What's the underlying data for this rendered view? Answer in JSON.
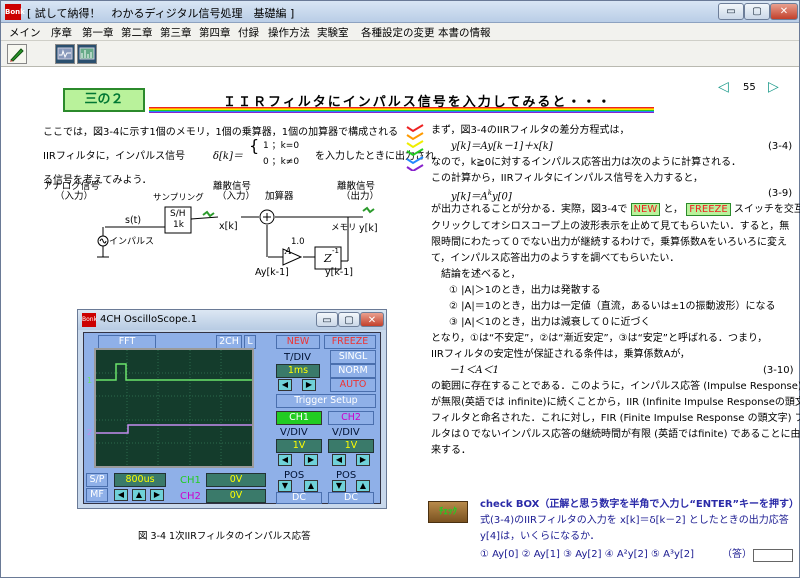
{
  "window": {
    "app_icon": "Bonk",
    "title": "[ 試して納得！　わかるディジタル信号処理　基礎編 ]",
    "min_glyph": "▭",
    "max_glyph": "▢",
    "close_glyph": "✕"
  },
  "menu": {
    "items": [
      "メイン",
      "序章",
      "第一章",
      "第二章",
      "第三章",
      "第四章",
      "付録",
      "操作方法",
      "実験室",
      "各種設定の変更",
      "本書の情報"
    ]
  },
  "page": {
    "section": "三の２",
    "title": "ＩＩＲフィルタにインパルス信号を入力してみると・・・",
    "page_number": "55",
    "prev_glyph": "◁",
    "next_glyph": "▷"
  },
  "left": {
    "p1": "ここでは，図3-4に示す1個のメモリ，1個の乗算器，1個の加算器で構成される",
    "p2": "IIRフィルタに，インパルス信号",
    "p2b": "δ[k]＝",
    "p2c": "を入力したときに出力され",
    "p3": "る信号を考えてみよう．",
    "case1": "1 ；k=0",
    "case2": "0 ；k≠0",
    "diagram": {
      "analog_in": "アナログ信号",
      "analog_in2": "（入力）",
      "st": "s(t)",
      "impulse": "インパルス",
      "sampling": "サンプリング",
      "sh": "S/H",
      "sh2": "1k",
      "discrete_in": "離散信号",
      "discrete_in2": "（入力）",
      "xk": "x[k]",
      "adder": "加算器",
      "discrete_out": "離散信号",
      "discrete_out2": "（出力）",
      "memory": "メモリ",
      "yk": "y[k]",
      "z": "Z",
      "zexp": "-1",
      "gain": "1.0",
      "a": "A",
      "ayk": "Ay[k-1]",
      "yk1": "y[k-1]"
    },
    "caption": "図 3-4  1次IIRフィルタのインパルス応答"
  },
  "scope": {
    "title": "4CH OscilloScope.1",
    "fft": "FFT",
    "two_ch": "2CH",
    "l": "L",
    "new": "NEW",
    "freeze": "FREEZE",
    "tdiv": "T/DIV",
    "singl": "SINGL",
    "time_val": "1ms",
    "norm": "NORM",
    "auto": "AUTO",
    "trigger": "Trigger Setup",
    "ch1": "CH1",
    "ch2": "CH2",
    "vdiv": "V/DIV",
    "v1": "1V",
    "v2": "1V",
    "pos": "POS",
    "dc": "DC",
    "sp": "S/P",
    "mf": "MF",
    "rate": "800us",
    "ch1_val": "0V",
    "ch2_val": "0V",
    "marker1": "1",
    "marker2": "2"
  },
  "right": {
    "l1": "まず，図3-4のIIRフィルタの差分方程式は，",
    "eq1": "y[k]＝Ay[k－1]＋x[k]",
    "eq1_no": "(3-4)",
    "l2": "なので，k≧0に対するインパルス応答出力は次のように計算される．",
    "l3": "この計算から，IIRフィルタにインパルス信号を入力すると，",
    "eq2": "y[k]＝A",
    "eq2_sup": "k",
    "eq2_b": "y[0]",
    "eq2_no": "(3-9)",
    "l4a": "が出力されることが分かる．実際，図3-4で",
    "btn_new": "NEW",
    "l4b": "と，",
    "btn_freeze": "FREEZE",
    "l4c": "スイッチを交互に",
    "l5": "クリックしてオシロスコープ上の波形表示を止めて見てもらいたい．すると，無",
    "l6": "限時間にわたって０でない出力が継続するわけで，乗算係数Aをいろいろに変え",
    "l7": "て，インパルス応答出力のようすを調べてもらいたい．",
    "l8": "結論を述べると，",
    "c1": "①  |A|＞1のとき，出力は発散する",
    "c2": "②  |A|＝1のとき，出力は一定値（直流，あるいは±1の振動波形）になる",
    "c3": "③  |A|＜1のとき，出力は減衰して０に近づく",
    "l9": "となり，①は“不安定”，②は“漸近安定”，③は“安定”と呼ばれる．つまり，",
    "l10": "IIRフィルタの安定性が保証される条件は，乗算係数Aが，",
    "eq3": "－1＜A＜1",
    "eq3_no": "(3-10)",
    "l11": "の範囲に存在することである．このように，インパルス応答 (Impulse Response)",
    "l12": "が無限(英語では infinite)に続くことから，IIR (Infinite Impulse Responseの頭文字)",
    "l13": "フィルタと命名された．これに対し，FIR (Finite Impulse Response の頭文字) フィ",
    "l14": "ルタは０でないインパルス応答の継続時間が有限 (英語ではfinite) であることに由",
    "l15": "来する．"
  },
  "check": {
    "icon_text": "ﾁｪｯｸ",
    "title": "check BOX（正解と思う数字を半角で入力し“ENTER”キーを押す）",
    "q1": "式(3-4)のIIRフィルタの入力を x[k]＝δ[k－2] としたときの出力応答",
    "q2": "y[4]は，いくらになるか．",
    "opts": "① Ay[0]   ② Ay[1]   ③ Ay[2]   ④ A²y[2]   ⑤ A³y[2]",
    "ans_label": "（答）"
  }
}
